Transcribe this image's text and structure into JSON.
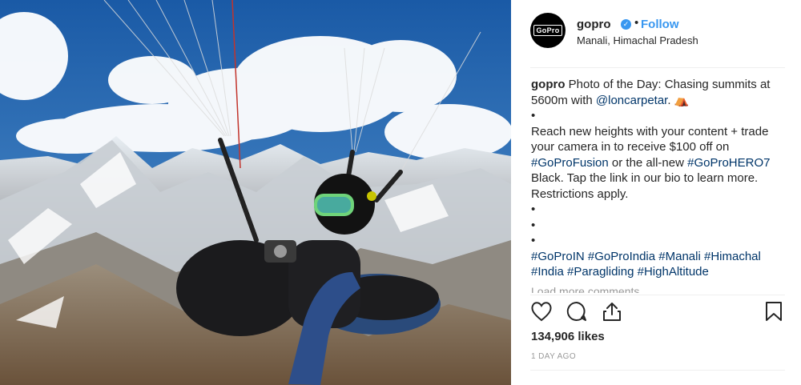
{
  "post": {
    "username": "gopro",
    "verified_icon": "verified-badge-icon",
    "separator": "•",
    "follow_label": "Follow",
    "location": "Manali, Himachal Pradesh",
    "avatar_text": "GoPro"
  },
  "caption": {
    "author": "gopro",
    "text1": "Photo of the Day: Chasing summits at 5600m with",
    "mention": "@loncarpetar",
    "emoji": "⛺",
    "bullet": "•",
    "text2": "Reach new heights with your content + trade your camera in to receive $100 off on",
    "tag1": "#GoProFusion",
    "text3": "or the all-new",
    "tag2": "#GoProHERO7",
    "text4": "Black. Tap the link in our bio to learn more. Restrictions apply.",
    "tags": [
      "#GoProIN",
      "#GoProIndia",
      "#Manali",
      "#Himachal",
      "#India",
      "#Paragliding",
      "#HighAltitude"
    ]
  },
  "load_more": "Load more comments",
  "actions": {
    "like_icon": "heart-icon",
    "comment_icon": "comment-icon",
    "share_icon": "share-icon",
    "save_icon": "bookmark-icon"
  },
  "likes": "134,906 likes",
  "time": "1 DAY AGO",
  "colors": {
    "link": "#003569",
    "follow": "#3897f0",
    "muted": "#999999"
  }
}
